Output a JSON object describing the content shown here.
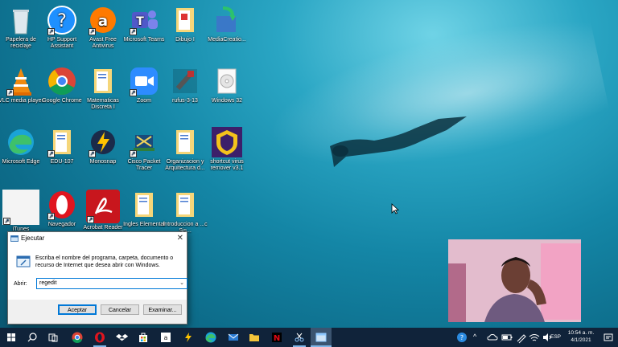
{
  "desktop": {
    "icons": [
      {
        "label": "Papelera de reciclaje"
      },
      {
        "label": "HP Support Assistant"
      },
      {
        "label": "Avast Free Antivirus"
      },
      {
        "label": "Microsoft Teams"
      },
      {
        "label": "Dibujo I"
      },
      {
        "label": "MediaCreatio..."
      },
      {
        "label": "VLC media player"
      },
      {
        "label": "Google Chrome"
      },
      {
        "label": "Matematicas Discreta I"
      },
      {
        "label": "Zoom"
      },
      {
        "label": "rufus-3-13"
      },
      {
        "label": "Windows 32"
      },
      {
        "label": "Microsoft Edge"
      },
      {
        "label": "EDU-107"
      },
      {
        "label": "Monosnap"
      },
      {
        "label": "Cisco Packet Tracer"
      },
      {
        "label": "Organizacion y Arquitectura d..."
      },
      {
        "label": "shortcut virus remover v3.1"
      },
      {
        "label": "iTunes"
      },
      {
        "label": "Navegador"
      },
      {
        "label": "Acrobat Reader"
      },
      {
        "label": "Ingles Elemental"
      },
      {
        "label": "Introduccion a ...c Sis..."
      }
    ]
  },
  "run_dialog": {
    "title": "Ejecutar",
    "description": "Escriba el nombre del programa, carpeta, documento o recurso de Internet que desea abrir con Windows.",
    "open_label": "Abrir:",
    "open_value": "regedit",
    "ok": "Aceptar",
    "cancel": "Cancelar",
    "browse": "Examinar..."
  },
  "taskbar": {
    "language": "ESP",
    "time": "10:54 a. m.",
    "date": "4/1/2021"
  },
  "colors": {
    "taskbar": "#10233a",
    "accent": "#0078d7"
  }
}
